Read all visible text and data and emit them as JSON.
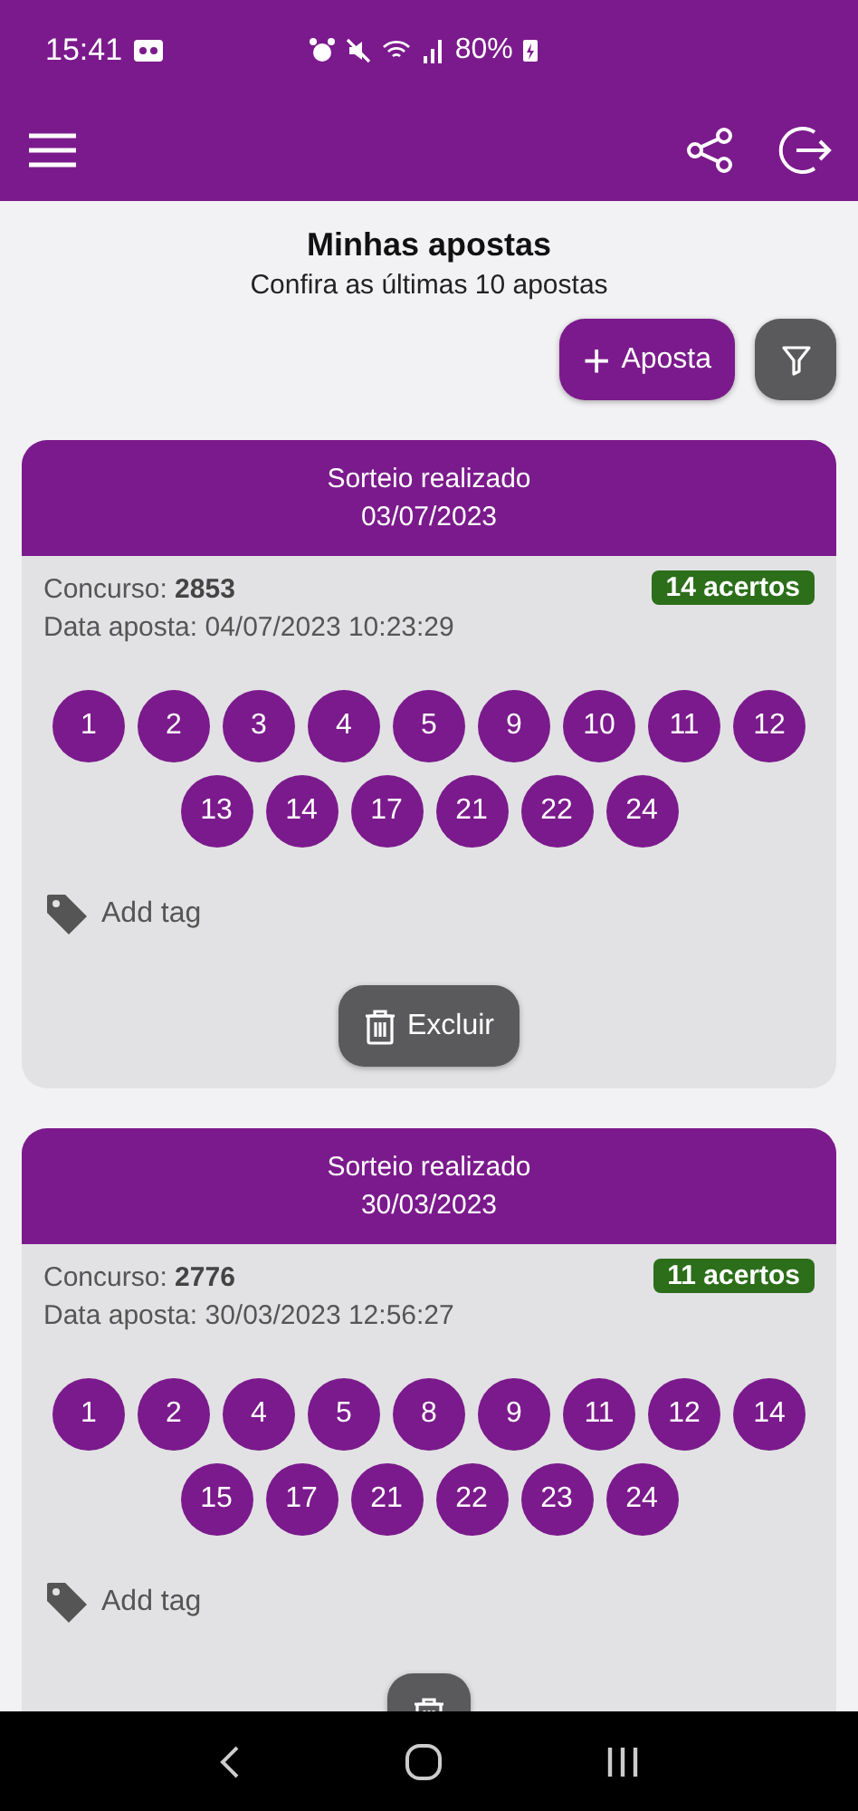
{
  "status_bar": {
    "time": "15:41",
    "battery": "80%"
  },
  "page": {
    "title": "Minhas apostas",
    "subtitle": "Confira as últimas 10 apostas",
    "add_button": "Aposta",
    "add_icon": "+"
  },
  "bets": [
    {
      "status": "Sorteio realizado",
      "draw_date": "03/07/2023",
      "contest_label": "Concurso:",
      "contest": "2853",
      "date_label": "Data aposta:",
      "bet_date": "04/07/2023 10:23:29",
      "hits": "14 acertos",
      "numbers": [
        "1",
        "2",
        "3",
        "4",
        "5",
        "9",
        "10",
        "11",
        "12",
        "13",
        "14",
        "17",
        "21",
        "22",
        "24"
      ],
      "tag": "Add tag",
      "delete_label": "Excluir"
    },
    {
      "status": "Sorteio realizado",
      "draw_date": "30/03/2023",
      "contest_label": "Concurso:",
      "contest": "2776",
      "date_label": "Data aposta:",
      "bet_date": "30/03/2023 12:56:27",
      "hits": "11 acertos",
      "numbers": [
        "1",
        "2",
        "4",
        "5",
        "8",
        "9",
        "11",
        "12",
        "14",
        "15",
        "17",
        "21",
        "22",
        "23",
        "24"
      ],
      "tag": "Add tag"
    }
  ]
}
